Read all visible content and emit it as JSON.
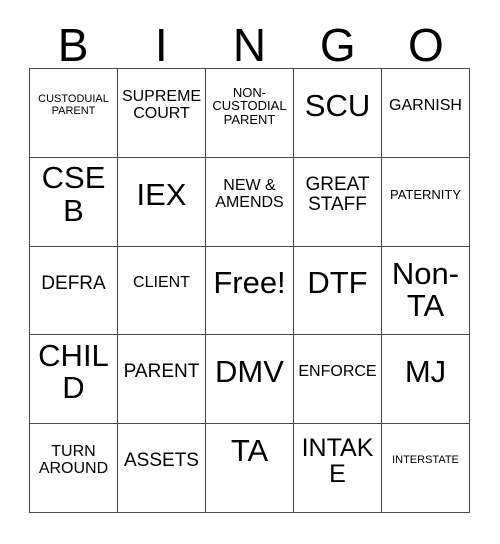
{
  "card": {
    "header": {
      "letters": [
        "B",
        "I",
        "N",
        "G",
        "O"
      ]
    },
    "rows": [
      {
        "cells": [
          {
            "text": "CUSTODUIAL PARENT",
            "size": "xs",
            "align": "up"
          },
          {
            "text": "SUPREME COURT",
            "size": "md",
            "align": "up"
          },
          {
            "text": "NON-CUSTODIAL PARENT",
            "size": "sm",
            "align": "up"
          },
          {
            "text": "SCU",
            "size": "xxl",
            "align": "up"
          },
          {
            "text": "GARNISH",
            "size": "md",
            "align": "up"
          }
        ]
      },
      {
        "cells": [
          {
            "text": "CSEB",
            "size": "xxl",
            "align": "up"
          },
          {
            "text": "IEX",
            "size": "xxl",
            "align": "up"
          },
          {
            "text": "NEW & AMENDS",
            "size": "md",
            "align": "up"
          },
          {
            "text": "GREAT STAFF",
            "size": "lg",
            "align": "up"
          },
          {
            "text": "PATERNITY",
            "size": "sm",
            "align": "up"
          }
        ]
      },
      {
        "cells": [
          {
            "text": "DEFRA",
            "size": "lg",
            "align": "up"
          },
          {
            "text": "CLIENT",
            "size": "md",
            "align": "up"
          },
          {
            "text": "Free!",
            "size": "xxl",
            "align": "up"
          },
          {
            "text": "DTF",
            "size": "xxl",
            "align": "up"
          },
          {
            "text": "Non-TA",
            "size": "xxl",
            "align": "none"
          }
        ]
      },
      {
        "cells": [
          {
            "text": "CHILD",
            "size": "xxl",
            "align": "up"
          },
          {
            "text": "PARENT",
            "size": "lg",
            "align": "up"
          },
          {
            "text": "DMV",
            "size": "xxl",
            "align": "up"
          },
          {
            "text": "ENFORCE",
            "size": "md",
            "align": "up"
          },
          {
            "text": "MJ",
            "size": "xxl",
            "align": "up"
          }
        ]
      },
      {
        "cells": [
          {
            "text": "TURN AROUND",
            "size": "md",
            "align": "up"
          },
          {
            "text": "ASSETS",
            "size": "lg",
            "align": "up"
          },
          {
            "text": "TA",
            "size": "xxl",
            "align": "up-lg"
          },
          {
            "text": "INTAKE",
            "size": "xl",
            "align": "up"
          },
          {
            "text": "INTERSTATE",
            "size": "xs",
            "align": "up"
          }
        ]
      }
    ]
  }
}
